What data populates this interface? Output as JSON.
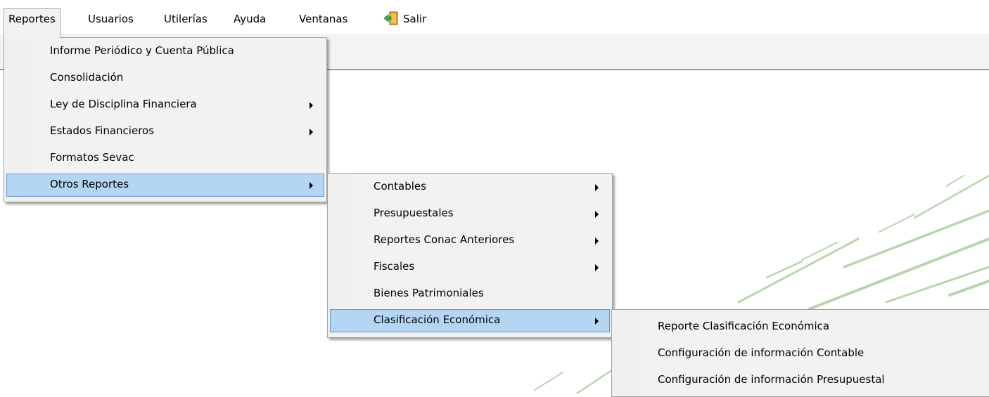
{
  "menubar": {
    "items": [
      {
        "label": "Reportes"
      },
      {
        "label": "Usuarios"
      },
      {
        "label": "Utilerías"
      },
      {
        "label": "Ayuda"
      },
      {
        "label": "Ventanas"
      },
      {
        "label": "Salir"
      }
    ]
  },
  "reportes_menu": {
    "items": [
      {
        "label": "Informe Periódico y Cuenta Pública"
      },
      {
        "label": "Consolidación"
      },
      {
        "label": "Ley de Disciplina Financiera",
        "submenu": true
      },
      {
        "label": "Estados Financieros",
        "submenu": true
      },
      {
        "label": "Formatos Sevac"
      },
      {
        "label": "Otros Reportes",
        "submenu": true,
        "highlighted": true
      }
    ]
  },
  "otros_reportes_menu": {
    "items": [
      {
        "label": "Contables",
        "submenu": true
      },
      {
        "label": "Presupuestales",
        "submenu": true
      },
      {
        "label": "Reportes Conac Anteriores",
        "submenu": true
      },
      {
        "label": "Fiscales",
        "submenu": true
      },
      {
        "label": "Bienes Patrimoniales"
      },
      {
        "label": "Clasificación Económica",
        "submenu": true,
        "highlighted": true
      }
    ]
  },
  "clasificacion_menu": {
    "items": [
      {
        "label": "Reporte Clasificación Económica"
      },
      {
        "label": "Configuración de información Contable"
      },
      {
        "label": "Configuración de información Presupuestal"
      }
    ]
  },
  "colors": {
    "highlight": "#b5d6f3",
    "highlight_border": "#5b9bd6",
    "menu_bg": "#f2f2f2",
    "watermark": "#a8c9a0"
  }
}
